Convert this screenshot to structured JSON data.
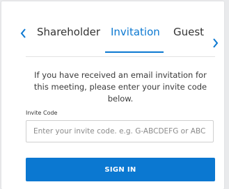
{
  "tabs": [
    {
      "label": "Shareholder",
      "active": false
    },
    {
      "label": "Invitation",
      "active": true
    },
    {
      "label": "Guest",
      "active": false
    }
  ],
  "instructions": "If you have received an email invitation for this meeting, please enter your invite code below.",
  "invite_code": {
    "label": "Invite Code",
    "placeholder": "Enter your invite code. e.g. G-ABCDEFG or ABCD",
    "value": ""
  },
  "signin_label": "SIGN IN",
  "colors": {
    "accent": "#0b78d1",
    "text": "#333333",
    "background": "#e9eaec"
  },
  "icons": {
    "left": "chevron-left-icon",
    "right": "chevron-right-icon"
  }
}
